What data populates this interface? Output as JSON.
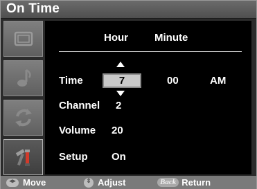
{
  "title": "On Time",
  "columns": {
    "hour": "Hour",
    "minute": "Minute"
  },
  "rows": {
    "time": {
      "label": "Time",
      "hour": "7",
      "minute": "00",
      "ampm": "AM"
    },
    "channel": {
      "label": "Channel",
      "value": "2"
    },
    "volume": {
      "label": "Volume",
      "value": "20"
    },
    "setup": {
      "label": "Setup",
      "value": "On"
    }
  },
  "sidebar": {
    "icons": [
      "picture-icon",
      "sound-icon",
      "channel-icon",
      "setup-icon"
    ],
    "active_index": 3
  },
  "help_bar": {
    "move": "Move",
    "adjust": "Adjust",
    "back_key": "Back",
    "return": "Return"
  },
  "colors": {
    "panel_background": "#000000",
    "frame": "#2b2b2b",
    "title_bar": "#5c5c5c",
    "highlight_box": "#c9c9c9",
    "bottom_bar": "#7a7a7a"
  }
}
